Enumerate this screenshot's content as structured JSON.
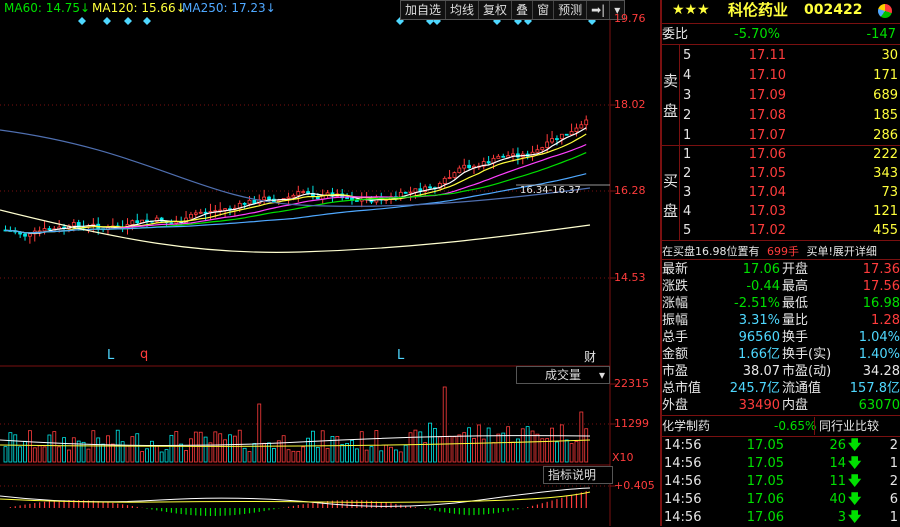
{
  "ma_indicators": [
    {
      "label": "MA60: 14.75",
      "arrow": "↓",
      "color": "#00e000"
    },
    {
      "label": "MA120: 15.66",
      "arrow": "↓",
      "color": "#ffff3c"
    },
    {
      "label": "MA250: 17.23",
      "arrow": "↓",
      "color": "#4fa8ff"
    }
  ],
  "toolbar": [
    "加自选",
    "均线",
    "复权",
    "叠",
    "窗",
    "预测",
    "➡|",
    "▾"
  ],
  "price_axis": [
    "19.76",
    "18.02",
    "16.28",
    "14.53"
  ],
  "price_annotation": "16.34-16.37",
  "markers": [
    "L",
    "q",
    "L",
    "财"
  ],
  "volume_selector": "成交量",
  "volume_axis": [
    "22315",
    "11299",
    "X10"
  ],
  "indicator_button": "指标说明",
  "indicator_axis": "0.405",
  "stock": {
    "stars": "★★★",
    "name": "科伦药业",
    "code": "002422"
  },
  "weibi": {
    "label": "委比",
    "pct": "-5.70%",
    "diff": "-147"
  },
  "sell_label": [
    "卖",
    "盘"
  ],
  "buy_label": [
    "买",
    "盘"
  ],
  "sell": [
    {
      "lvl": "5",
      "price": "17.11",
      "vol": "30"
    },
    {
      "lvl": "4",
      "price": "17.10",
      "vol": "171"
    },
    {
      "lvl": "3",
      "price": "17.09",
      "vol": "689"
    },
    {
      "lvl": "2",
      "price": "17.08",
      "vol": "185"
    },
    {
      "lvl": "1",
      "price": "17.07",
      "vol": "286"
    }
  ],
  "buy": [
    {
      "lvl": "1",
      "price": "17.06",
      "vol": "222"
    },
    {
      "lvl": "2",
      "price": "17.05",
      "vol": "343"
    },
    {
      "lvl": "3",
      "price": "17.04",
      "vol": "73"
    },
    {
      "lvl": "4",
      "price": "17.03",
      "vol": "121"
    },
    {
      "lvl": "5",
      "price": "17.02",
      "vol": "455"
    }
  ],
  "notice": {
    "pre": "在买盘16.98位置有",
    "hands": "699手",
    "post": "买单!",
    "link": "展开详细"
  },
  "quote": [
    {
      "l": "最新",
      "v": "17.06",
      "vc": "green",
      "l2": "开盘",
      "v2": "17.36",
      "v2c": "red"
    },
    {
      "l": "涨跌",
      "v": "-0.44",
      "vc": "green",
      "l2": "最高",
      "v2": "17.56",
      "v2c": "red"
    },
    {
      "l": "涨幅",
      "v": "-2.51%",
      "vc": "green",
      "l2": "最低",
      "v2": "16.98",
      "v2c": "green"
    },
    {
      "l": "振幅",
      "v": "3.31%",
      "vc": "cyan",
      "l2": "量比",
      "v2": "1.28",
      "v2c": "red"
    },
    {
      "l": "总手",
      "v": "96560",
      "vc": "cyan",
      "l2": "换手",
      "v2": "1.04%",
      "v2c": "cyan"
    },
    {
      "l": "金额",
      "v": "1.66亿",
      "vc": "cyan",
      "l2": "换手(实)",
      "v2": "1.40%",
      "v2c": "cyan"
    },
    {
      "l": "市盈",
      "v": "38.07",
      "vc": "white",
      "l2": "市盈(动)",
      "v2": "34.28",
      "v2c": "white"
    },
    {
      "l": "总市值",
      "v": "245.7亿",
      "vc": "cyan",
      "l2": "流通值",
      "v2": "157.8亿",
      "v2c": "cyan"
    },
    {
      "l": "外盘",
      "v": "33490",
      "vc": "red",
      "l2": "内盘",
      "v2": "63070",
      "v2c": "green"
    }
  ],
  "sector": {
    "name": "化学制药",
    "pct": "-0.65%",
    "button": "同行业比较"
  },
  "ticks": [
    {
      "t": "14:56",
      "p": "17.05",
      "v": "26",
      "n": "2"
    },
    {
      "t": "14:56",
      "p": "17.05",
      "v": "14",
      "n": "1"
    },
    {
      "t": "14:56",
      "p": "17.05",
      "v": "11",
      "n": "2"
    },
    {
      "t": "14:56",
      "p": "17.06",
      "v": "40",
      "n": "6"
    },
    {
      "t": "14:56",
      "p": "17.06",
      "v": "3",
      "n": "1"
    }
  ],
  "colors": {
    "up": "#ff3c3c",
    "down": "#00e000",
    "grid": "#7a1010",
    "bg": "#000000"
  }
}
